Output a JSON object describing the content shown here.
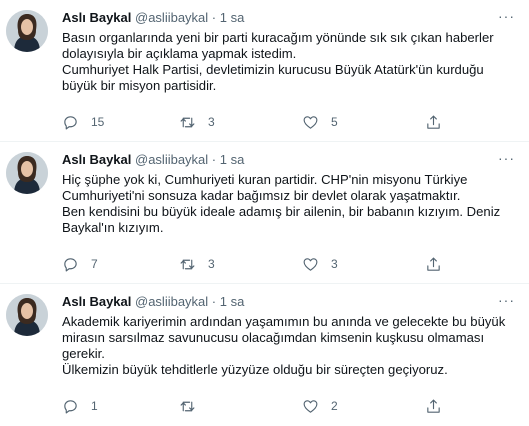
{
  "tweets": [
    {
      "name": "Aslı Baykal",
      "handle": "@asliibaykal",
      "dot": "·",
      "time": "1 sa",
      "more": "···",
      "lines": [
        "Basın organlarında yeni bir parti kuracağım yönünde sık sık çıkan haberler",
        "dolayısıyla bir açıklama yapmak istedim.",
        "Cumhuriyet Halk Partisi, devletimizin kurucusu Büyük Atatürk'ün kurduğu",
        "büyük bir misyon partisidir."
      ],
      "replies": "15",
      "retweets": "3",
      "likes": "5"
    },
    {
      "name": "Aslı Baykal",
      "handle": "@asliibaykal",
      "dot": "·",
      "time": "1 sa",
      "more": "···",
      "lines": [
        "Hiç şüphe yok ki, Cumhuriyeti kuran partidir. CHP'nin misyonu Türkiye",
        "Cumhuriyeti'ni sonsuza kadar bağımsız bir devlet olarak yaşatmaktır.",
        "Ben kendisini bu büyük ideale adamış bir ailenin, bir babanın kızıyım. Deniz",
        "Baykal'ın kızıyım."
      ],
      "replies": "7",
      "retweets": "3",
      "likes": "3"
    },
    {
      "name": "Aslı Baykal",
      "handle": "@asliibaykal",
      "dot": "·",
      "time": "1 sa",
      "more": "···",
      "lines": [
        "Akademik kariyerimin ardından yaşamımın bu anında ve gelecekte bu büyük",
        "mirasın sarsılmaz savunucusu olacağımdan kimsenin kuşkusu olmaması",
        "gerekir.",
        "Ülkemizin büyük tehditlerle yüzyüze olduğu bir süreçten geçiyoruz."
      ],
      "replies": "1",
      "retweets": "",
      "likes": "2"
    }
  ],
  "icons": {
    "reply": "reply-icon",
    "retweet": "retweet-icon",
    "like": "heart-icon",
    "share": "share-icon",
    "more": "more-icon"
  },
  "colors": {
    "text": "#0f1419",
    "secondary": "#536471",
    "divider": "#eff3f4"
  }
}
